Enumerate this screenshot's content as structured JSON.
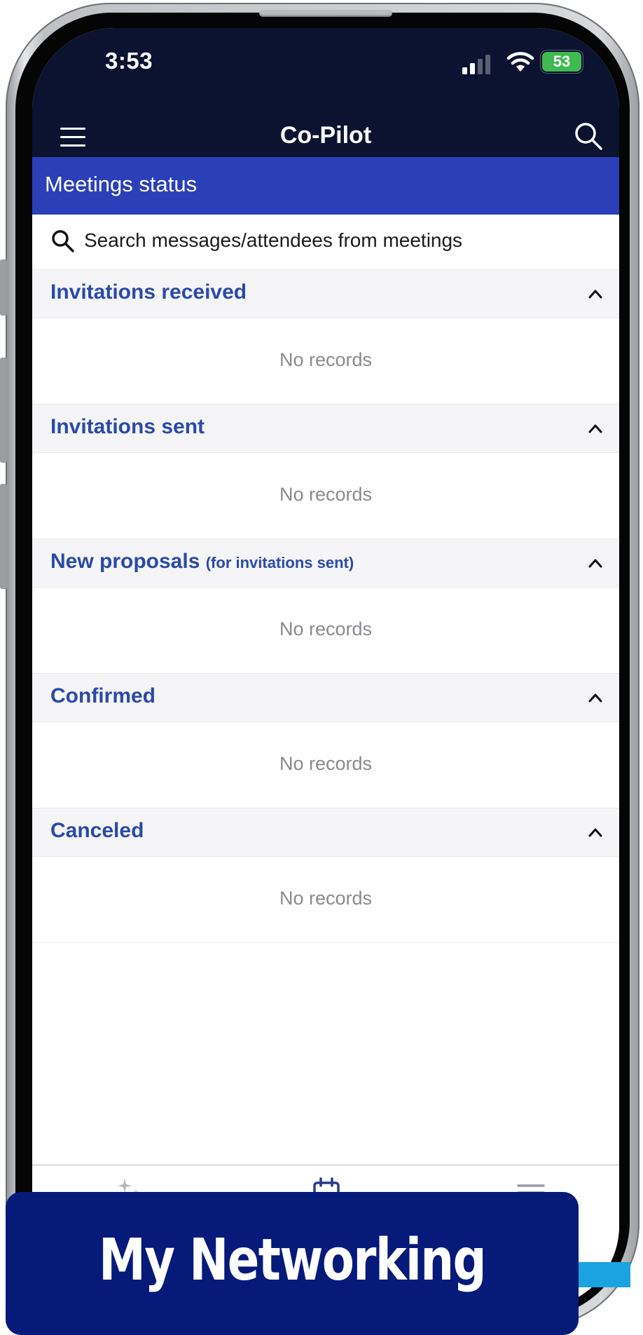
{
  "status_bar": {
    "time": "3:53",
    "battery": "53"
  },
  "header": {
    "title": "Co-Pilot",
    "menu_icon": "hamburger-menu-icon",
    "search_icon": "search-icon"
  },
  "banner": {
    "title": "Meetings status"
  },
  "search": {
    "placeholder": "Search messages/attendees from meetings"
  },
  "sections": [
    {
      "title": "Invitations received",
      "subtitle": "",
      "empty_text": "No records"
    },
    {
      "title": "Invitations sent",
      "subtitle": "",
      "empty_text": "No records"
    },
    {
      "title": "New proposals",
      "subtitle": "(for invitations sent)",
      "empty_text": "No records"
    },
    {
      "title": "Confirmed",
      "subtitle": "",
      "empty_text": "No records"
    },
    {
      "title": "Canceled",
      "subtitle": "",
      "empty_text": "No records"
    }
  ],
  "tabbar": {
    "icons": [
      "sparkle-icon",
      "calendar-icon",
      "list-icon"
    ]
  },
  "overlay": {
    "label": "My Networking"
  },
  "colors": {
    "header_bg": "#0b1331",
    "banner_bg": "#2a3fb8",
    "section_title": "#2b4aa8",
    "overlay_bg": "#061a7a",
    "battery_green": "#3fb950"
  }
}
